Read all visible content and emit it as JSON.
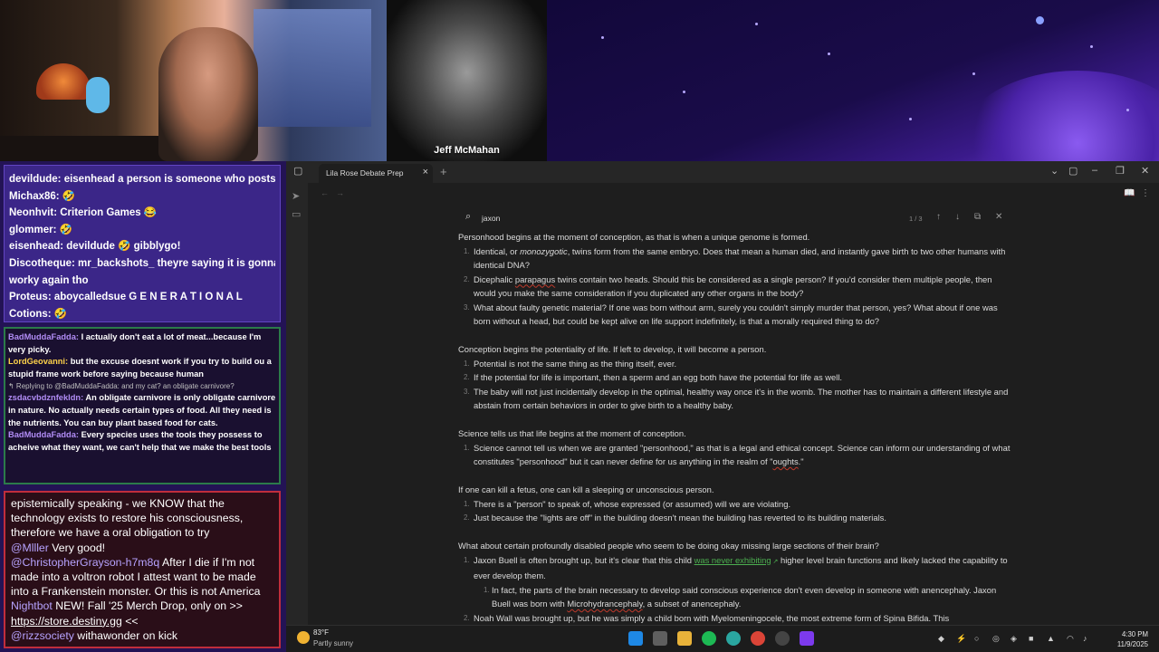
{
  "stream": {
    "guest_name": "Jeff McMahan"
  },
  "chat_top": [
    "devildude: eisenhead a person is someone who posts 🤣",
    "Michax86: 🤣",
    "Neonhvit: Criterion Games 😂",
    "glommer: 🤣",
    "eisenhead: devildude 🤣 gibblygo!",
    "Discotheque: mr_backshots_ theyre saying it is gonna",
    "worky again tho",
    "Proteus: aboycalledsue G E N E R A T I O N A L",
    "Cotions: 🤣"
  ],
  "chat_mid": {
    "m1_user": "BadMuddaFadda:",
    "m1_text": " I actually don't eat a lot of meat...because I'm very picky.",
    "m2_user": "LordGeovanni:",
    "m2_text": " but the excuse doesnt work if you try to build ou a stupid frame work before saying because human",
    "reply": "↰ Replying to @BadMuddaFadda: and my cat? an obligate carnivore?",
    "m3_user": "zsdacvbdznfekldn:",
    "m3_text": " An obligate carnivore is only obligate carnivore in nature. No actually needs certain types of food. All they need is the nutrients. You can buy plant based food for cats.",
    "m4_user": "BadMuddaFadda:",
    "m4_text": " Every species uses the tools they possess to acheive what they want, we can't help that we make the best tools"
  },
  "chat_bottom": {
    "l1": "epistemically speaking - we KNOW that the technology exists to restore his consciousness, therefore we have a oral obligation to try",
    "u2": "@Mlller",
    "t2": " Very good!",
    "u3": "@ChristopherGrayson-h7m8q",
    "t3": " After I die if I'm not made into a voltron robot I attest want to be made into a Frankenstein monster. Or this is not America",
    "u4": "Nightbot",
    "t4": " NEW! Fall '25 Merch Drop, only on >> ",
    "link4": "https://store.destiny.gg",
    "t4b": " <<",
    "u5": "@rizzsociety",
    "t5": " withawonder on kick"
  },
  "window": {
    "tab_label": "Lila Rose Debate Prep"
  },
  "search": {
    "value": "jaxon",
    "count": "1 / 3"
  },
  "doc": {
    "p1": "Personhood begins at the moment of conception, as that is when a unique genome is formed.",
    "p1_items": [
      {
        "a": "Identical, or ",
        "em": "monozygotic",
        "b": ", twins form from the same embryo. Does that mean a human died, and instantly gave birth to two other humans with identical DNA?"
      },
      {
        "a": "Dicephalic ",
        "spell": "parapagus",
        "b": " twins contain two heads. Should this be considered as a single person? If you'd consider them multiple people, then would you make the same consideration if you duplicated any other organs in the body?"
      },
      {
        "a": "What about faulty genetic material? If one was born without arm, surely you couldn't simply murder that person, yes? What about if one was born without a head, but could be kept alive on life support indefinitely, is that a morally required thing to do?"
      }
    ],
    "p2": "Conception begins the potentiality of life. If left to develop, it will become a person.",
    "p2_items": [
      "Potential is not the same thing as the thing itself, ever.",
      "If the potential for life is important, then a sperm and an egg both have the potential for life as well.",
      "The baby will not just incidentally develop in the optimal, healthy way once it's in the womb. The mother has to maintain a different lifestyle and abstain from certain behaviors in order to give birth to a healthy baby."
    ],
    "p3": "Science tells us that life begins at the moment of conception.",
    "p3_item_a": "Science cannot tell us when we are granted \"personhood,\" as that is a legal and ethical concept. Science can inform our understanding of what constitutes \"personhood\" but it can never define for us anything in the realm of \"",
    "p3_item_spell": "oughts",
    "p3_item_b": ".\"",
    "p4": "If one can kill a fetus, one can kill a sleeping or unconscious person.",
    "p4_items": [
      "There is a \"person\" to speak of, whose expressed (or assumed) will we are violating.",
      "Just because the \"lights are off\" in the building doesn't mean the building has reverted to its building materials."
    ],
    "p5": "What about certain profoundly disabled people who seem to be doing okay missing large sections of their brain?",
    "p5_item1_a": "Jaxon Buell is often brought up, but it's clear that this child ",
    "p5_item1_link": "was never exhibiting",
    "p5_item1_b": " higher level brain functions and likely lacked the capability to ever develop them.",
    "p5_sub_a": "In fact, the parts of the brain necessary to develop said conscious experience don't even develop in someone with anencephaly. Jaxon Buell was born with ",
    "p5_sub_spell": "Microhydrancephaly",
    "p5_sub_b": ", a subset of anencephaly.",
    "p5_item2": "Noah Wall was brought up, but he was simply a child born with Myelomeningocele, the most extreme form of Spina Bifida. This"
  },
  "taskbar": {
    "temp": "83°F",
    "weather": "Partly sunny",
    "time": "4:30 PM",
    "date": "11/9/2025"
  },
  "colors": {
    "accent_link": "#4caf50",
    "chat_purple": "#3b2688",
    "chat_red_border": "#c02d3c"
  }
}
